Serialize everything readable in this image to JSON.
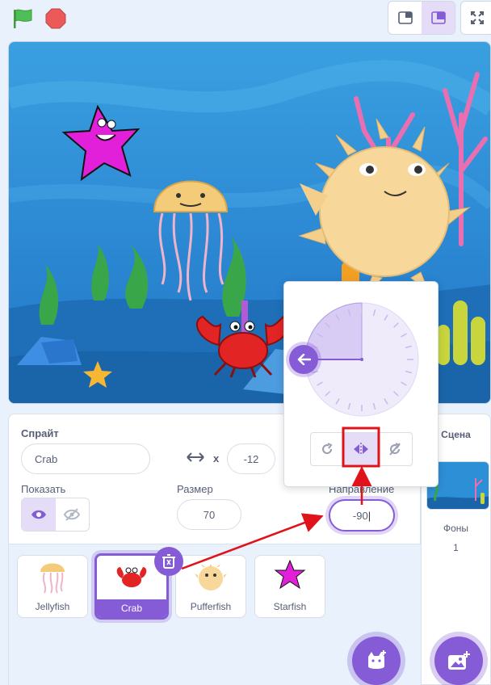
{
  "sprite_info": {
    "sprite_label": "Спрайт",
    "sprite_name": "Crab",
    "x_label": "x",
    "x_value": "-12",
    "show_label": "Показать",
    "size_label": "Размер",
    "size_value": "70",
    "direction_label": "Направление",
    "direction_value": "-90"
  },
  "sprites": [
    {
      "name": "Jellyfish",
      "selected": false
    },
    {
      "name": "Crab",
      "selected": true
    },
    {
      "name": "Pufferfish",
      "selected": false
    },
    {
      "name": "Starfish",
      "selected": false
    }
  ],
  "stage_panel": {
    "title": "Сцена",
    "backdrops_label": "Фоны",
    "backdrops_count": "1"
  },
  "direction_popover": {
    "direction_degrees": -90,
    "rotation_modes": [
      "all-around",
      "left-right",
      "dont-rotate"
    ],
    "active_mode": "left-right"
  },
  "colors": {
    "accent": "#855cd6",
    "highlight_box": "#e0121a",
    "stage_water": "#2d8fd6"
  },
  "icons": {
    "flag": "green-flag-icon",
    "stop": "stop-icon",
    "small_stage": "small-stage-icon",
    "large_stage": "large-stage-icon",
    "fullscreen": "fullscreen-icon",
    "trash": "trash-icon",
    "add_sprite": "add-sprite-icon",
    "add_backdrop": "add-backdrop-icon"
  }
}
